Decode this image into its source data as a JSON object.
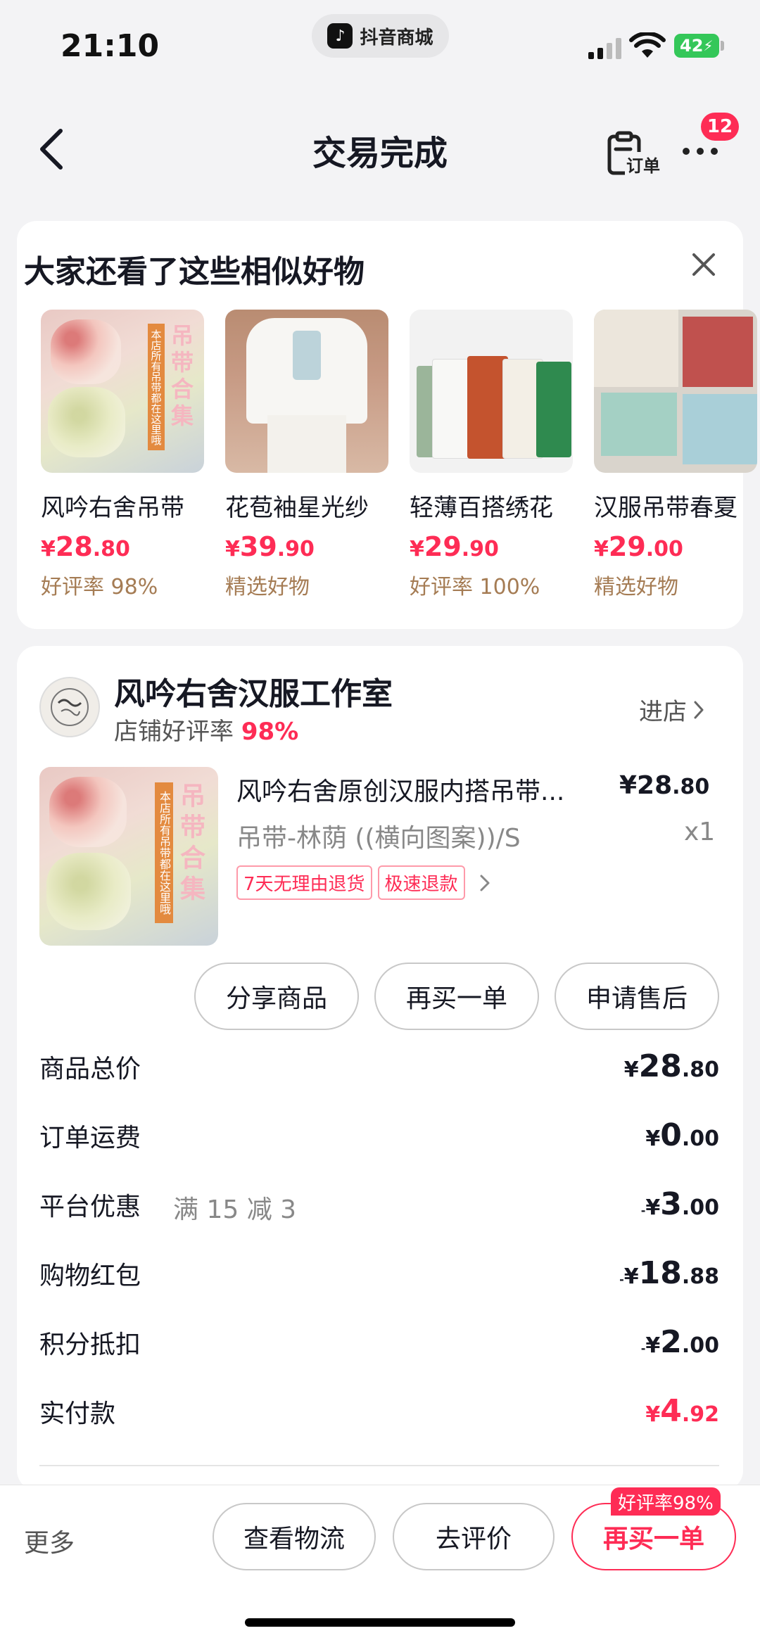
{
  "status_bar": {
    "time": "21:10",
    "app_label": "抖音商城",
    "battery": "42"
  },
  "nav": {
    "title": "交易完成",
    "orders_label": "订单",
    "badge_count": "12"
  },
  "recommend": {
    "title": "大家还看了这些相似好物",
    "items": [
      {
        "name": "风吟右舍吊带",
        "price_int": "28",
        "price_dec": ".80",
        "tag": "好评率 98%"
      },
      {
        "name": "花苞袖星光纱",
        "price_int": "39",
        "price_dec": ".90",
        "tag": "精选好物"
      },
      {
        "name": "轻薄百搭绣花",
        "price_int": "29",
        "price_dec": ".90",
        "tag": "好评率 100%"
      },
      {
        "name": "汉服吊带春夏",
        "price_int": "29",
        "price_dec": ".00",
        "tag": "精选好物"
      }
    ],
    "thumb_text": {
      "side": "本店所有吊带都在这里哦",
      "main": "吊带合集"
    }
  },
  "shop": {
    "name": "风吟右舍汉服工作室",
    "rating_label": "店铺好评率",
    "rating_value": "98%",
    "enter_label": "进店"
  },
  "product": {
    "title": "风吟右舍原创汉服内搭吊带...",
    "price_int": "¥28",
    "price_dec": ".80",
    "spec": "吊带-林荫 ((横向图案))/S",
    "qty": "x1",
    "tags": [
      "7天无理由退货",
      "极速退款"
    ]
  },
  "actions": {
    "share": "分享商品",
    "rebuy": "再买一单",
    "after_sale": "申请售后"
  },
  "fees": [
    {
      "label": "商品总价",
      "note": "",
      "prefix": "",
      "int": "28",
      "dec": ".80",
      "red": false
    },
    {
      "label": "订单运费",
      "note": "",
      "prefix": "",
      "int": "0",
      "dec": ".00",
      "red": false
    },
    {
      "label": "平台优惠",
      "note": "满 15 减 3",
      "prefix": "-",
      "int": "3",
      "dec": ".00",
      "red": false
    },
    {
      "label": "购物红包",
      "note": "",
      "prefix": "-",
      "int": "18",
      "dec": ".88",
      "red": false
    },
    {
      "label": "积分抵扣",
      "note": "",
      "prefix": "-",
      "int": "2",
      "dec": ".00",
      "red": false
    },
    {
      "label": "实付款",
      "note": "",
      "prefix": "",
      "int": "4",
      "dec": ".92",
      "red": true
    }
  ],
  "bottom": {
    "more": "更多",
    "logistics": "查看物流",
    "review": "去评价",
    "rebuy": "再买一单",
    "rebuy_badge": "好评率98%"
  },
  "colors": {
    "accent": "#fe2c55",
    "tag_brown": "#a57c54"
  }
}
